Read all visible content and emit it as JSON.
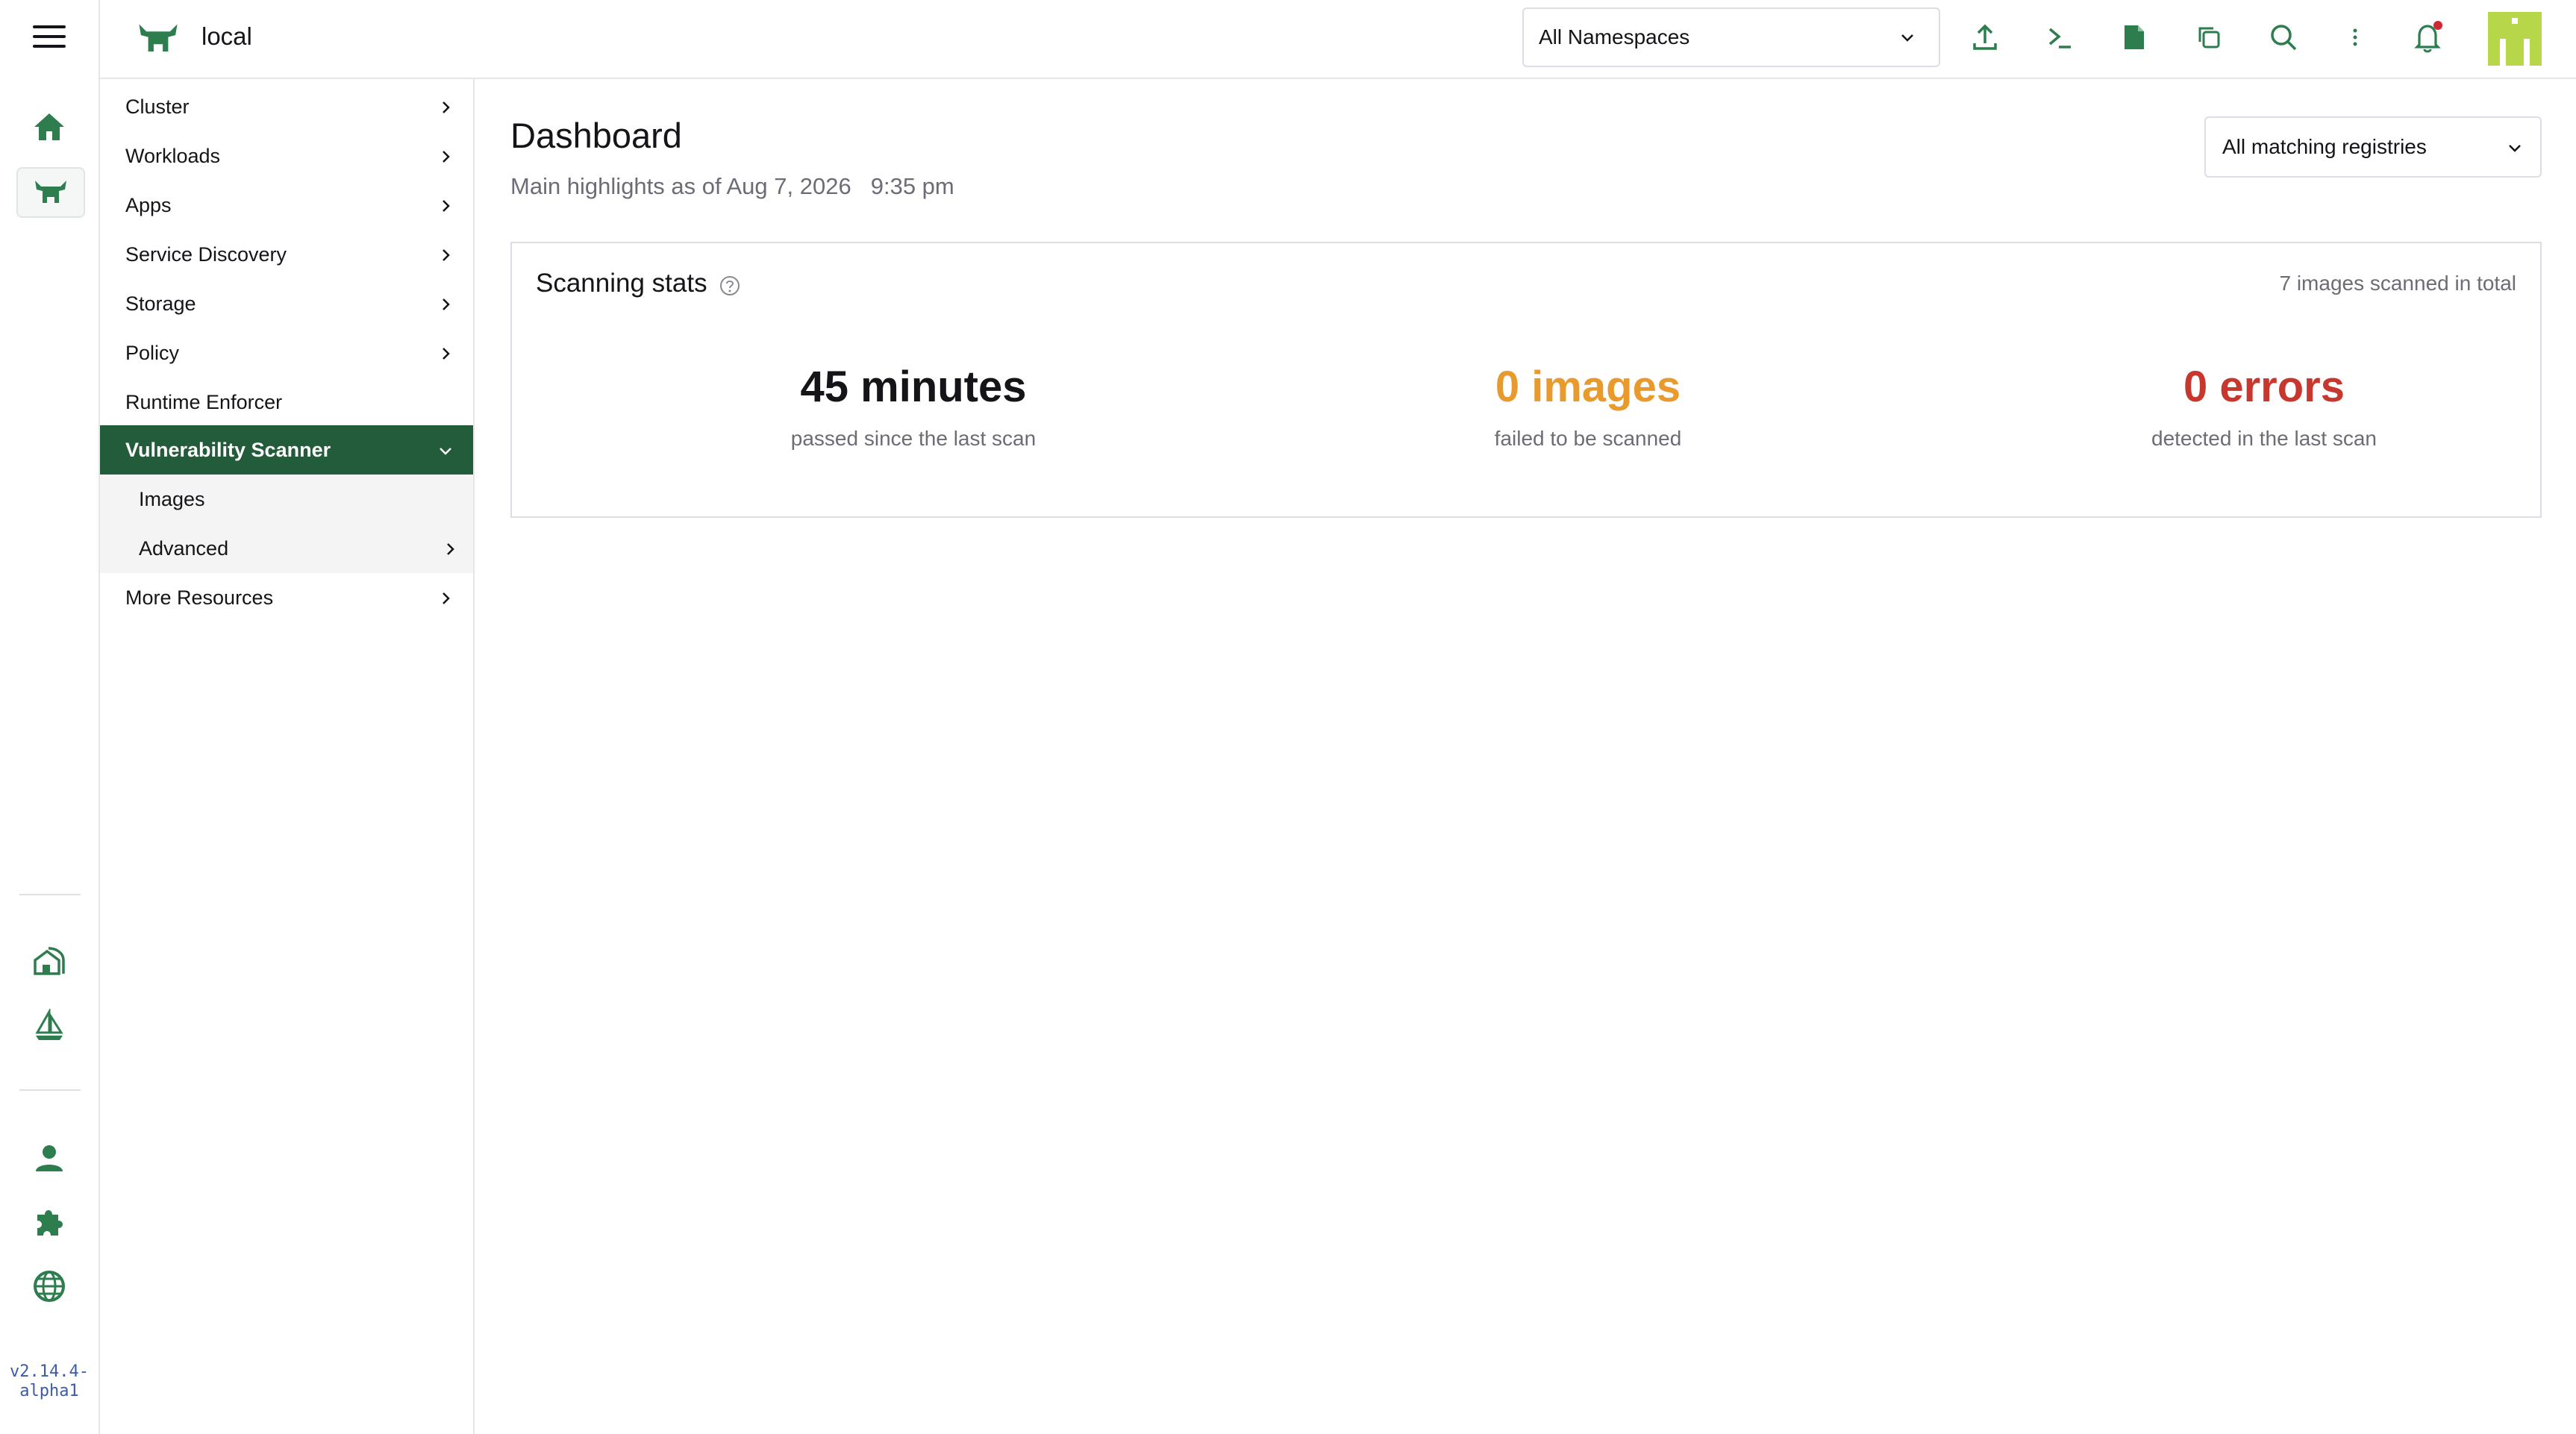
{
  "rail": {
    "version": "v2.14.4-alpha1"
  },
  "header": {
    "cluster_name": "local",
    "namespace_select": "All Namespaces"
  },
  "sidenav": {
    "items": [
      {
        "label": "Cluster"
      },
      {
        "label": "Workloads"
      },
      {
        "label": "Apps"
      },
      {
        "label": "Service Discovery"
      },
      {
        "label": "Storage"
      },
      {
        "label": "Policy"
      },
      {
        "label": "Runtime Enforcer"
      },
      {
        "label": "Vulnerability Scanner"
      },
      {
        "label": "Images"
      },
      {
        "label": "Advanced"
      },
      {
        "label": "More Resources"
      }
    ]
  },
  "main": {
    "title": "Dashboard",
    "subtitle": "Main highlights as of Aug 7, 2026",
    "subtitle_time": "9:35 pm",
    "registry_select": "All matching registries",
    "stats": {
      "title": "Scanning stats",
      "total": "7 images scanned in total",
      "items": [
        {
          "value": "45 minutes",
          "label": "passed since the last scan"
        },
        {
          "value": "0 images",
          "label": "failed to be scanned"
        },
        {
          "value": "0 errors",
          "label": "detected in the last scan"
        }
      ]
    }
  },
  "colors": {
    "brand_green": "#235c3a",
    "icon_green": "#2e7d4f",
    "warning_orange": "#e89a2c",
    "error_red": "#c8372d",
    "avatar_lime": "#b7d64a",
    "notification_dot": "#d0282e"
  }
}
